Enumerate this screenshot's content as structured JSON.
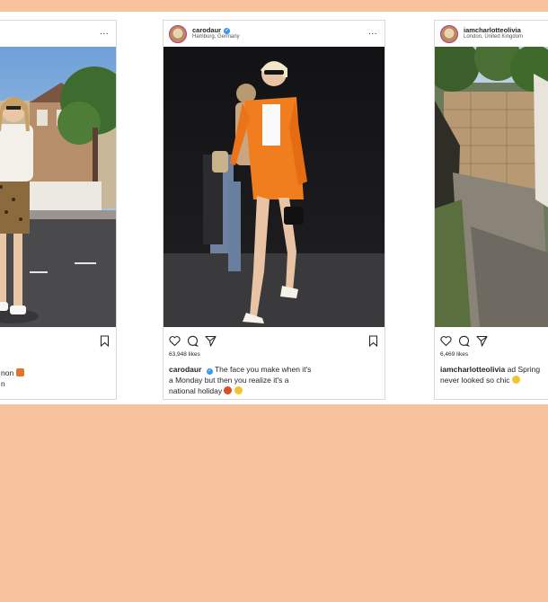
{
  "posts": [
    {
      "username": "",
      "location": "",
      "more": "...",
      "likes": "",
      "caption_user": "",
      "caption_text": "non",
      "caption_line2": "n"
    },
    {
      "username": "carodaur",
      "location": "Hamburg, Germany",
      "more": "...",
      "likes": "63,948 likes",
      "caption_user": "carodaur",
      "caption_text": "The face you make when it's a Monday but then you realize it's a national holiday",
      "caption_line2": ""
    },
    {
      "username": "iamcharlotteolivia",
      "location": "London, United Kingdom",
      "more": "",
      "likes": "6,469 likes",
      "caption_user": "iamcharlotteolivia",
      "caption_text": "ad Spring never looked so chic",
      "caption_line2": ""
    }
  ],
  "icons": {
    "like": "heart-icon",
    "comment": "comment-icon",
    "share": "share-icon",
    "save": "bookmark-icon",
    "verified": "verified-badge-icon"
  },
  "colors": {
    "background": "#f8c29e",
    "verified": "#3897f0",
    "text": "#262626",
    "border": "#d9d9d9"
  }
}
